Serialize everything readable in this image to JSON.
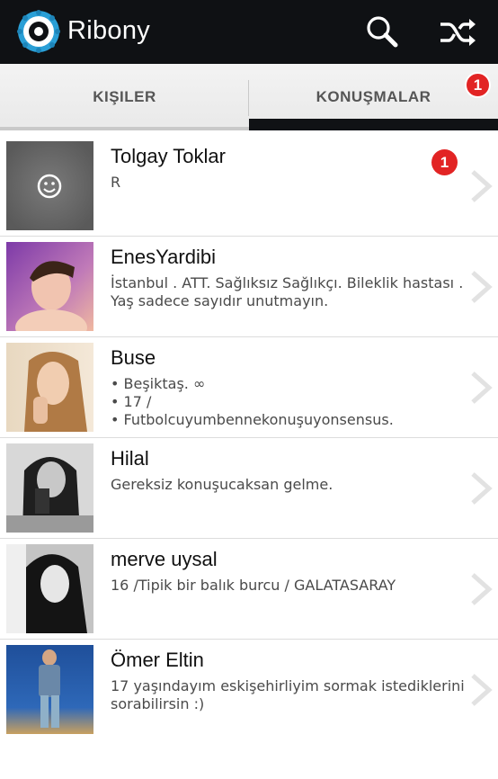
{
  "app": {
    "title": "Ribony",
    "logo_icon": "ribony-ring-logo",
    "colors": {
      "appbar": "#0f1114",
      "badge": "#e22424",
      "accent": "#2a9fd6"
    }
  },
  "actions": {
    "search_icon": "search-icon",
    "shuffle_icon": "shuffle-icon"
  },
  "tabs": [
    {
      "label": "KIŞILER",
      "active": false
    },
    {
      "label": "KONUŞMALAR",
      "active": true,
      "badge": "1"
    }
  ],
  "conversations": [
    {
      "name": "Tolgay Toklar",
      "status": [
        "R"
      ],
      "badge": "1",
      "avatar": "default-smiley-avatar"
    },
    {
      "name": "EnesYardibi",
      "status": [
        "İstanbul . ATT. Sağlıksız Sağlıkçı. Bileklik hastası .",
        "Yaş sadece sayıdır unutmayın."
      ],
      "avatar": "profile-photo"
    },
    {
      "name": "Buse",
      "status": [
        "• Beşiktaş. ∞",
        "• 17 /",
        "• Futbolcuyumbennekonuşuyonsensus."
      ],
      "avatar": "profile-photo"
    },
    {
      "name": "Hilal",
      "status": [
        "Gereksiz konuşucaksan gelme."
      ],
      "avatar": "profile-photo"
    },
    {
      "name": "merve uysal",
      "status": [
        "16 /Tipik bir balık burcu / GALATASARAY"
      ],
      "avatar": "profile-photo"
    },
    {
      "name": "Ömer Eltin",
      "status": [
        "17 yaşındayım eskişehirliyim sormak istediklerini",
        "sorabilirsin :)"
      ],
      "avatar": "profile-photo"
    }
  ]
}
